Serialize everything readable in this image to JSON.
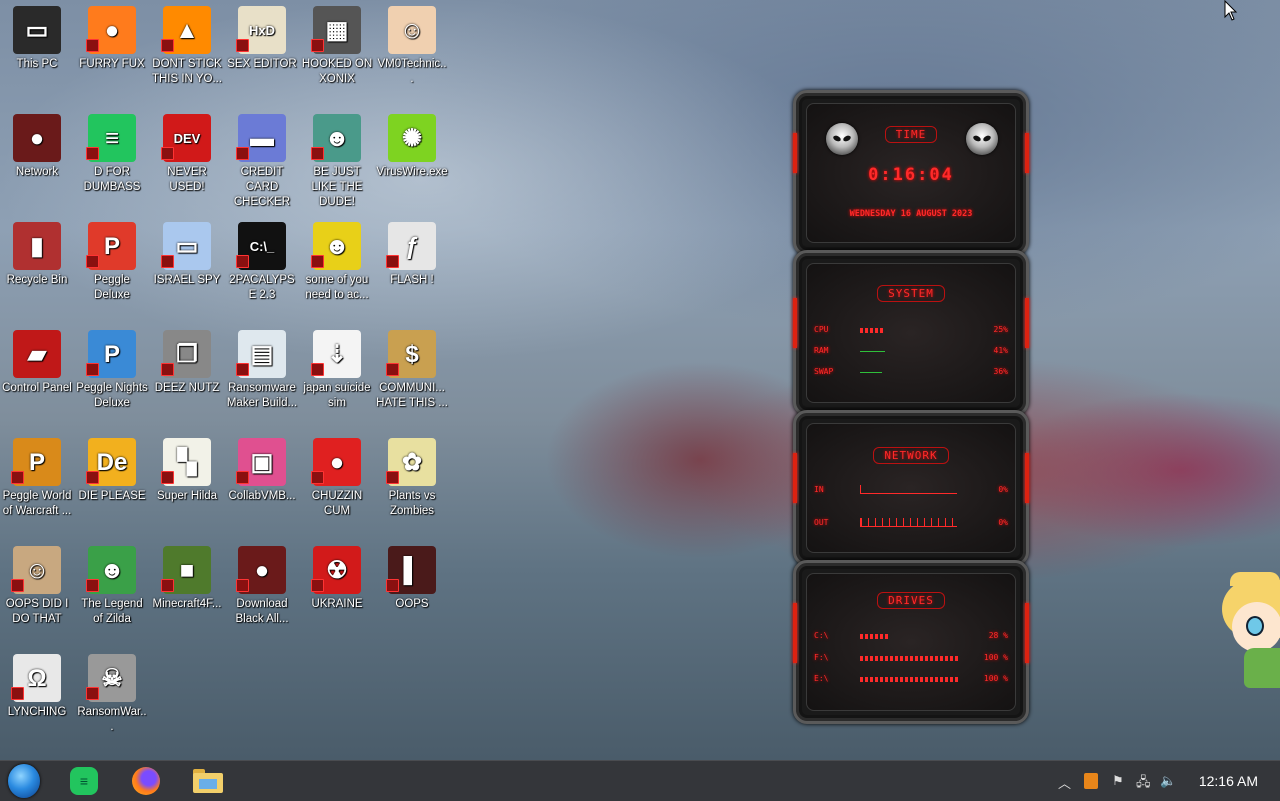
{
  "desktop": {
    "icons": [
      {
        "label": "This PC",
        "icon": "computer-icon",
        "color": "#2a2a2a",
        "glyph": "▭",
        "badge": false
      },
      {
        "label": "FURRY FUX",
        "icon": "firefox-icon",
        "color": "#ff7b1c",
        "glyph": "●",
        "badge": true
      },
      {
        "label": "DONT STICK THIS IN YO...",
        "icon": "vlc-cone-icon",
        "color": "#ff8a00",
        "glyph": "▲",
        "badge": true
      },
      {
        "label": "SEX EDITOR",
        "icon": "hxd-editor-icon",
        "color": "#e8e0c8",
        "glyph": "HxD",
        "badge": true
      },
      {
        "label": "HOOKED ON XONIX",
        "icon": "xonix-game-icon",
        "color": "#555555",
        "glyph": "▦",
        "badge": true
      },
      {
        "label": "VM0Technic...",
        "icon": "doctor-icon",
        "color": "#f0d0b0",
        "glyph": "☺",
        "badge": false
      },
      {
        "label": "Network",
        "icon": "alien-network-icon",
        "color": "#6a1a1a",
        "glyph": "●",
        "badge": false
      },
      {
        "label": "D FOR DUMBASS",
        "icon": "chat-app-icon",
        "color": "#22c55e",
        "glyph": "≡",
        "badge": true
      },
      {
        "label": "NEVER USED!",
        "icon": "devcpp-icon",
        "color": "#d11919",
        "glyph": "DEV",
        "badge": true
      },
      {
        "label": "CREDIT CARD CHECKER",
        "icon": "credit-card-icon",
        "color": "#6b7bd6",
        "glyph": "▬",
        "badge": true
      },
      {
        "label": "BE JUST LIKE THE DUDE!",
        "icon": "santa-photo-icon",
        "color": "#4a9a8a",
        "glyph": "☻",
        "badge": true
      },
      {
        "label": "VirusWire.exe",
        "icon": "limewire-icon",
        "color": "#7ed321",
        "glyph": "✺",
        "badge": false
      },
      {
        "label": "Recycle Bin",
        "icon": "recycle-bin-icon",
        "color": "#b03030",
        "glyph": "▮",
        "badge": false
      },
      {
        "label": "Peggle Deluxe",
        "icon": "peggle-icon",
        "color": "#e03a2a",
        "glyph": "P",
        "badge": true
      },
      {
        "label": "ISRAEL SPY",
        "icon": "network-computers-icon",
        "color": "#aac8ee",
        "glyph": "▭",
        "badge": true
      },
      {
        "label": "2PACALYPSE 2.3",
        "icon": "terminal-icon",
        "color": "#111111",
        "glyph": "C:\\_",
        "badge": true
      },
      {
        "label": "some of you need to ac...",
        "icon": "beaver-icon",
        "color": "#e8d018",
        "glyph": "☻",
        "badge": true
      },
      {
        "label": "FLASH !",
        "icon": "flash-icon",
        "color": "#e6e6e6",
        "glyph": "ƒ",
        "badge": true
      },
      {
        "label": "Control Panel",
        "icon": "control-panel-icon",
        "color": "#c01818",
        "glyph": "▰",
        "badge": false
      },
      {
        "label": "Peggle Nights Deluxe",
        "icon": "peggle-nights-icon",
        "color": "#3a8ad6",
        "glyph": "P",
        "badge": true
      },
      {
        "label": "DEEZ NUTZ",
        "icon": "stacked-windows-icon",
        "color": "#888888",
        "glyph": "❐",
        "badge": true
      },
      {
        "label": "Ransomware Maker Build...",
        "icon": "ransomware-maker-icon",
        "color": "#dfe8ee",
        "glyph": "▤",
        "badge": true
      },
      {
        "label": "japan suicide sim",
        "icon": "japan-sim-icon",
        "color": "#f4f4f4",
        "glyph": "⇣",
        "badge": true
      },
      {
        "label": "COMMUNI... HATE THIS ...",
        "icon": "money-bag-icon",
        "color": "#c9a050",
        "glyph": "$",
        "badge": true
      },
      {
        "label": "Peggle World of Warcraft ...",
        "icon": "peggle-wow-icon",
        "color": "#d98a1a",
        "glyph": "P",
        "badge": true
      },
      {
        "label": "DIE PLEASE",
        "icon": "de-app-icon",
        "color": "#f2b01e",
        "glyph": "De",
        "badge": true
      },
      {
        "label": "Super Hilda",
        "icon": "pixel-cat-icon",
        "color": "#f2f2e8",
        "glyph": "▚",
        "badge": true
      },
      {
        "label": "CollabVMB...",
        "icon": "collabvm-icon",
        "color": "#e05090",
        "glyph": "▣",
        "badge": true
      },
      {
        "label": "CHUZZIN CUM",
        "icon": "chuzzle-icon",
        "color": "#e02020",
        "glyph": "●",
        "badge": true
      },
      {
        "label": "Plants vs Zombies",
        "icon": "plants-vs-zombies-icon",
        "color": "#e8e0a0",
        "glyph": "✿",
        "badge": true
      },
      {
        "label": "OOPS DID I DO THAT",
        "icon": "portrait-icon",
        "color": "#c8a880",
        "glyph": "☺",
        "badge": true
      },
      {
        "label": "The Legend of Zilda",
        "icon": "pixel-hero-icon",
        "color": "#3aa048",
        "glyph": "☻",
        "badge": true
      },
      {
        "label": "Minecraft4F...",
        "icon": "minecraft-icon",
        "color": "#4f7a2c",
        "glyph": "■",
        "badge": true
      },
      {
        "label": "Download Black All...",
        "icon": "alien-download-icon",
        "color": "#6a1a1a",
        "glyph": "●",
        "badge": true
      },
      {
        "label": "UKRAINE",
        "icon": "radiation-icon",
        "color": "#d21a1a",
        "glyph": "☢",
        "badge": true
      },
      {
        "label": "OOPS",
        "icon": "red-book-icon",
        "color": "#4a1a1a",
        "glyph": "▌",
        "badge": true
      },
      {
        "label": "LYNCHING",
        "icon": "rope-icon",
        "color": "#e8e8e8",
        "glyph": "Ω",
        "badge": true
      },
      {
        "label": "RansomWar...",
        "icon": "skull-icon",
        "color": "#999999",
        "glyph": "☠",
        "badge": true
      }
    ]
  },
  "widget": {
    "time": {
      "title": "TIME",
      "clock": "0:16:04",
      "date": "WEDNESDAY 16 AUGUST 2023"
    },
    "system": {
      "title": "SYSTEM",
      "rows": [
        {
          "key": "CPU",
          "value": "25%",
          "fill": 0.25
        },
        {
          "key": "RAM",
          "value": "41%",
          "fill": 0.41
        },
        {
          "key": "SWAP",
          "value": "36%",
          "fill": 0.36
        }
      ]
    },
    "network": {
      "title": "NETWORK",
      "rows": [
        {
          "key": "IN",
          "value": "0%"
        },
        {
          "key": "OUT",
          "value": "0%"
        }
      ]
    },
    "drives": {
      "title": "DRIVES",
      "rows": [
        {
          "key": "C:\\",
          "value": "28 %",
          "fill": 0.28
        },
        {
          "key": "F:\\",
          "value": "100 %",
          "fill": 1.0
        },
        {
          "key": "E:\\",
          "value": "100 %",
          "fill": 1.0
        }
      ]
    }
  },
  "taskbar": {
    "start": "start-orb-icon",
    "pinned": [
      {
        "icon": "chat-app-icon",
        "color": "#22c55e"
      },
      {
        "icon": "firefox-icon",
        "color": "#ff7b1c"
      },
      {
        "icon": "file-explorer-icon",
        "color": "#e8c45a"
      }
    ],
    "clock": "12:16 AM"
  }
}
